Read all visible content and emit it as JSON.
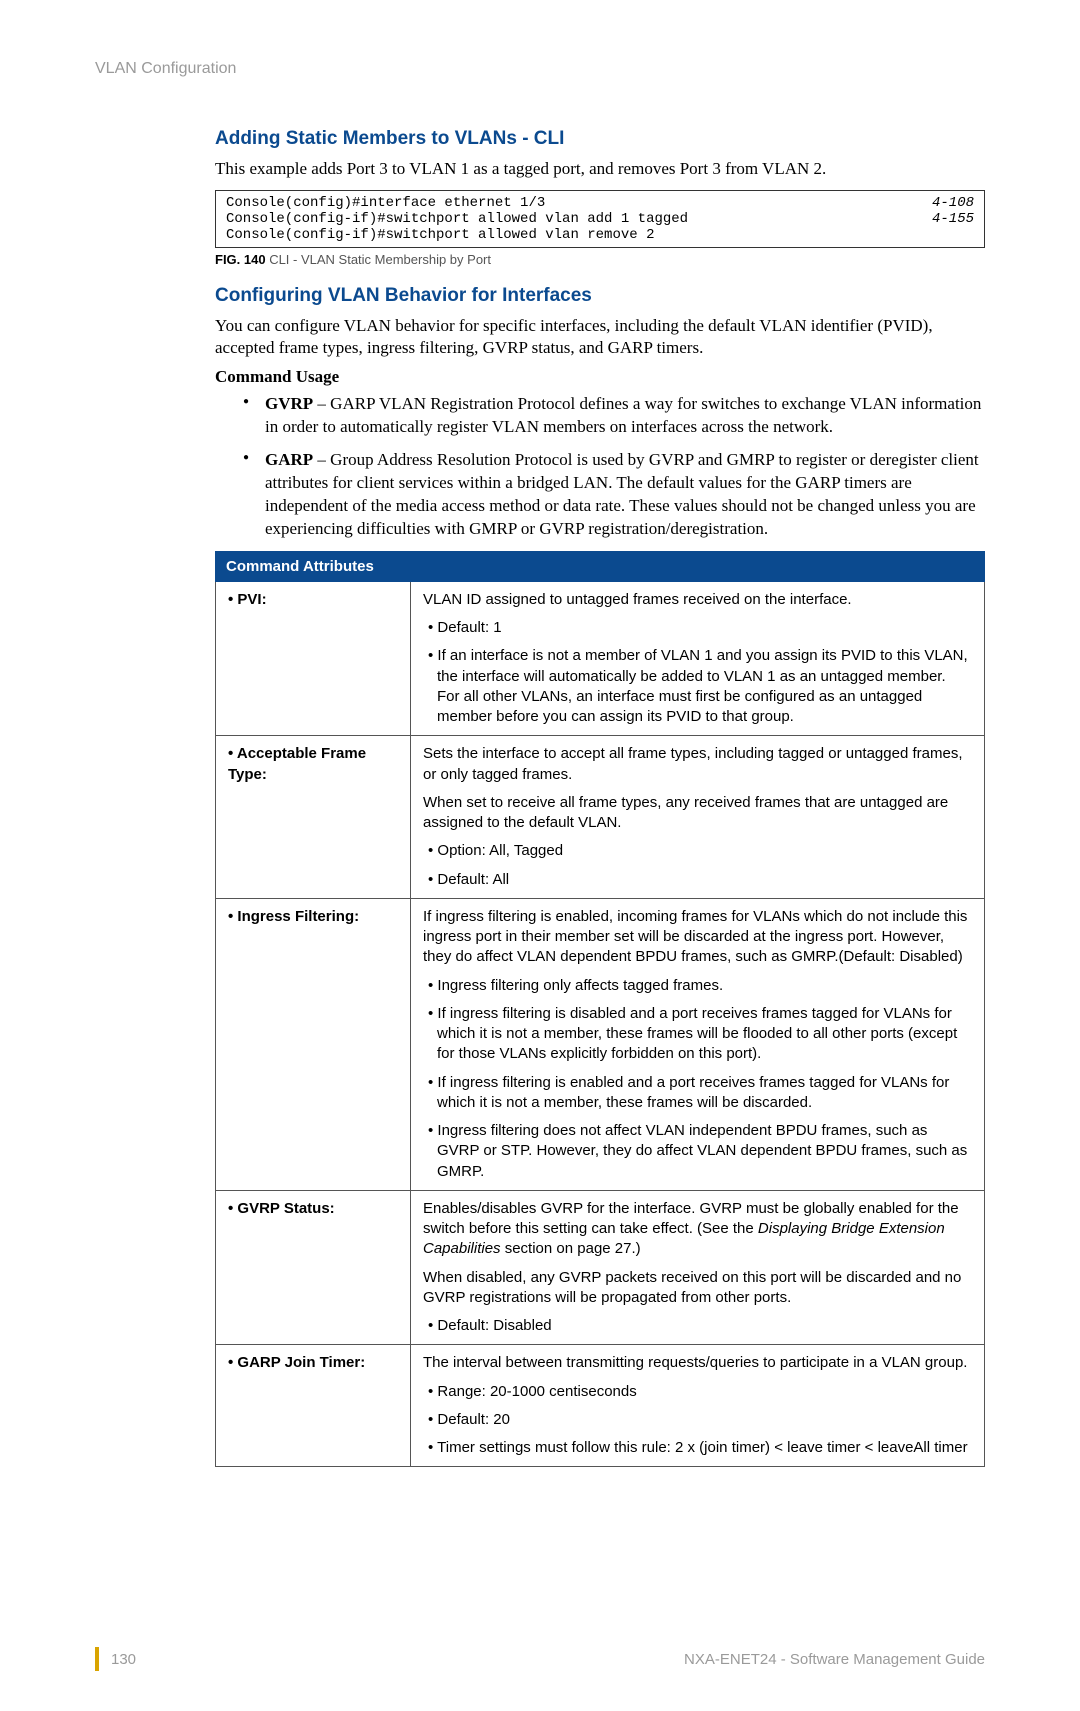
{
  "header": "VLAN Configuration",
  "section1": {
    "title": "Adding Static Members to VLANs - CLI",
    "intro": "This example adds Port 3 to VLAN 1 as a tagged port, and removes Port 3 from VLAN 2.",
    "code": {
      "lines": [
        {
          "left": "Console(config)#interface ethernet 1/3",
          "right": "4-108"
        },
        {
          "left": "Console(config-if)#switchport allowed vlan add 1 tagged",
          "right": "4-155"
        },
        {
          "left": "Console(config-if)#switchport allowed vlan remove 2",
          "right": ""
        }
      ]
    },
    "figure": {
      "label": "FIG. 140",
      "caption": "  CLI - VLAN Static Membership by Port"
    }
  },
  "section2": {
    "title": "Configuring VLAN Behavior for Interfaces",
    "intro": "You can configure VLAN behavior for specific interfaces, including the default VLAN identifier (PVID), accepted frame types, ingress filtering, GVRP status, and GARP timers.",
    "cmd_usage_label": "Command Usage",
    "bullets": {
      "gvrp_prefix": "GVRP",
      "gvrp": " – GARP VLAN Registration Protocol defines a way for switches to exchange VLAN information in order to automatically register VLAN members on interfaces across the network.",
      "garp_prefix": "GARP",
      "garp": " – Group Address Resolution Protocol is used by GVRP and GMRP to register or deregister client attributes for client services within a bridged LAN. The default values for the GARP timers are independent of the media access method or data rate. These values should not be changed unless you are experiencing difficulties with GMRP or GVRP registration/deregistration."
    },
    "table_header": "Command Attributes",
    "rows": {
      "pvi": {
        "label": "• PVI:",
        "desc1": "VLAN ID assigned to untagged frames received on the interface.",
        "b1": "Default: 1",
        "b2": "If an interface is not a member of VLAN 1 and you assign its PVID to this VLAN, the interface will automatically be added to VLAN 1 as an untagged member. For all other VLANs, an interface must first be configured as an untagged member before you can assign its PVID to that group."
      },
      "aft": {
        "label": "• Acceptable Frame Type:",
        "desc1": "Sets the interface to accept all frame types, including tagged or untagged frames, or only tagged frames.",
        "desc2": "When set to receive all frame types, any received frames that are untagged are assigned to the default VLAN.",
        "b1": "Option: All, Tagged",
        "b2": "Default: All"
      },
      "ingress": {
        "label": "• Ingress Filtering:",
        "desc1": "If ingress filtering is enabled, incoming frames for VLANs which do not include this ingress port in their member set will be discarded at the ingress port. However, they do affect VLAN dependent BPDU frames, such as GMRP.(Default: Disabled)",
        "b1": "Ingress filtering only affects tagged frames.",
        "b2": "If ingress filtering is disabled and a port receives frames tagged for VLANs for which it is not a member, these frames will be flooded to all other ports (except for those VLANs explicitly forbidden on this port).",
        "b3": "If ingress filtering is enabled and a port receives frames tagged for VLANs for which it is not a member, these frames will be discarded.",
        "b4": "Ingress filtering does not affect VLAN independent BPDU frames, such as GVRP or STP. However, they do affect VLAN dependent BPDU frames, such as GMRP."
      },
      "gvrp": {
        "label": "• GVRP Status:",
        "desc1a": "Enables/disables GVRP for the interface. GVRP must be globally enabled for the switch before this setting can take effect. (See the ",
        "desc1b": "Displaying Bridge Extension Capabilities",
        "desc1c": " section on page 27.)",
        "desc2": "When disabled, any GVRP packets received on this port will be discarded and no GVRP registrations will be propagated from other ports.",
        "b1": "Default: Disabled"
      },
      "garp": {
        "label": "• GARP Join Timer:",
        "desc1": "The interval between transmitting requests/queries to participate in a VLAN group.",
        "b1": "Range: 20-1000 centiseconds",
        "b2": "Default: 20",
        "b3": "Timer settings must follow this rule: 2 x (join timer) < leave timer < leaveAll timer"
      }
    }
  },
  "footer": {
    "page": "130",
    "doc": "NXA-ENET24 - Software Management Guide"
  }
}
